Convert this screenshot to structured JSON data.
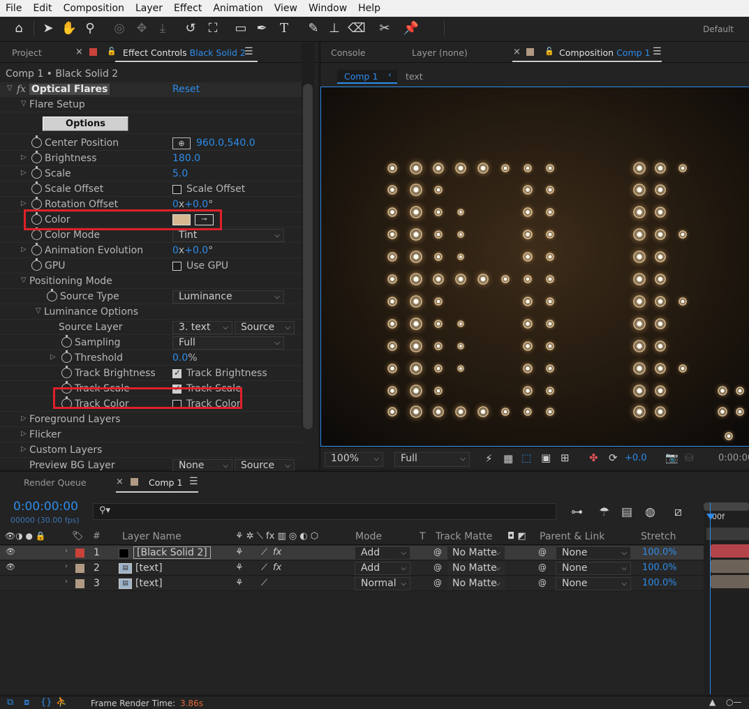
{
  "menu": [
    "File",
    "Edit",
    "Composition",
    "Layer",
    "Effect",
    "Animation",
    "View",
    "Window",
    "Help"
  ],
  "toolbar": {
    "workspace": "Default"
  },
  "left_panel": {
    "tabs": {
      "project": "Project",
      "effect_controls": "Effect Controls",
      "effect_controls_layer": "Black Solid 2"
    },
    "breadcrumb": "Comp 1 • Black Solid 2",
    "effect": {
      "fx": "fx",
      "name": "Optical Flares",
      "reset": "Reset"
    },
    "flare_setup": "Flare Setup",
    "options_button": "Options",
    "props": {
      "center_position": {
        "label": "Center Position",
        "value": "960.0,540.0"
      },
      "brightness": {
        "label": "Brightness",
        "value": "180.0"
      },
      "scale": {
        "label": "Scale",
        "value": "5.0"
      },
      "scale_offset": {
        "label": "Scale Offset",
        "checkbox": "Scale Offset"
      },
      "rotation_offset": {
        "label": "Rotation Offset",
        "value_prefix": "0",
        "value_x": "x",
        "value": "+0.0",
        "unit": "°"
      },
      "color": {
        "label": "Color",
        "swatch": "#d7b891"
      },
      "color_mode": {
        "label": "Color Mode",
        "value": "Tint"
      },
      "animation_evolution": {
        "label": "Animation Evolution",
        "value_prefix": "0",
        "value_x": "x",
        "value": "+0.0",
        "unit": "°"
      },
      "gpu": {
        "label": "GPU",
        "checkbox": "Use GPU"
      }
    },
    "positioning_mode": "Positioning Mode",
    "source_type": {
      "label": "Source Type",
      "value": "Luminance"
    },
    "luminance_options": "Luminance Options",
    "source_layer": {
      "label": "Source Layer",
      "value": "3. text",
      "value2": "Source"
    },
    "sampling": {
      "label": "Sampling",
      "value": "Full"
    },
    "threshold": {
      "label": "Threshold",
      "value": "0.0",
      "unit": "%"
    },
    "track_brightness": {
      "label": "Track Brightness",
      "checkbox": "Track Brightness"
    },
    "track_scale": {
      "label": "Track Scale",
      "checkbox": "Track Scale"
    },
    "track_color": {
      "label": "Track Color",
      "checkbox": "Track Color"
    },
    "foreground_layers": "Foreground Layers",
    "flicker": "Flicker",
    "custom_layers": "Custom Layers",
    "preview_bg_layer": {
      "label": "Preview BG Layer",
      "value": "None",
      "value2": "Source"
    }
  },
  "comp_panel": {
    "tabs": {
      "console": "Console",
      "layer": "Layer (none)",
      "composition": "Composition",
      "composition_name": "Comp 1"
    },
    "breadcrumbs": {
      "comp": "Comp 1",
      "text": "text"
    },
    "bottom": {
      "zoom": "100%",
      "resolution": "Full",
      "exposure": "+0.0",
      "time": "0:00:00"
    }
  },
  "timeline": {
    "tabs": {
      "render_queue": "Render Queue",
      "comp": "Comp 1"
    },
    "timecode": "0:00:00:00",
    "frames": "00000 (30.00 fps)",
    "ruler_label": "00f",
    "columns": {
      "num": "#",
      "layer_name": "Layer Name",
      "mode": "Mode",
      "t": "T",
      "track_matte": "Track Matte",
      "parent": "Parent & Link",
      "stretch": "Stretch"
    },
    "layers": [
      {
        "num": "1",
        "name": "[Black Solid 2]",
        "mode": "Add",
        "matte": "No Matte",
        "parent": "None",
        "stretch": "100.0%",
        "color": "#c9433a",
        "bar": "#b4444a"
      },
      {
        "num": "2",
        "name": "[text]",
        "mode": "Add",
        "matte": "No Matte",
        "parent": "None",
        "stretch": "100.0%",
        "color": "#b09a83",
        "bar": "#6d6258"
      },
      {
        "num": "3",
        "name": "[text]",
        "mode": "Normal",
        "matte": "No Matte",
        "parent": "None",
        "stretch": "100.0%",
        "color": "#b09a83",
        "bar": "#6d6258"
      }
    ]
  },
  "status": {
    "label": "Frame Render Time:",
    "value": "3.86s"
  }
}
